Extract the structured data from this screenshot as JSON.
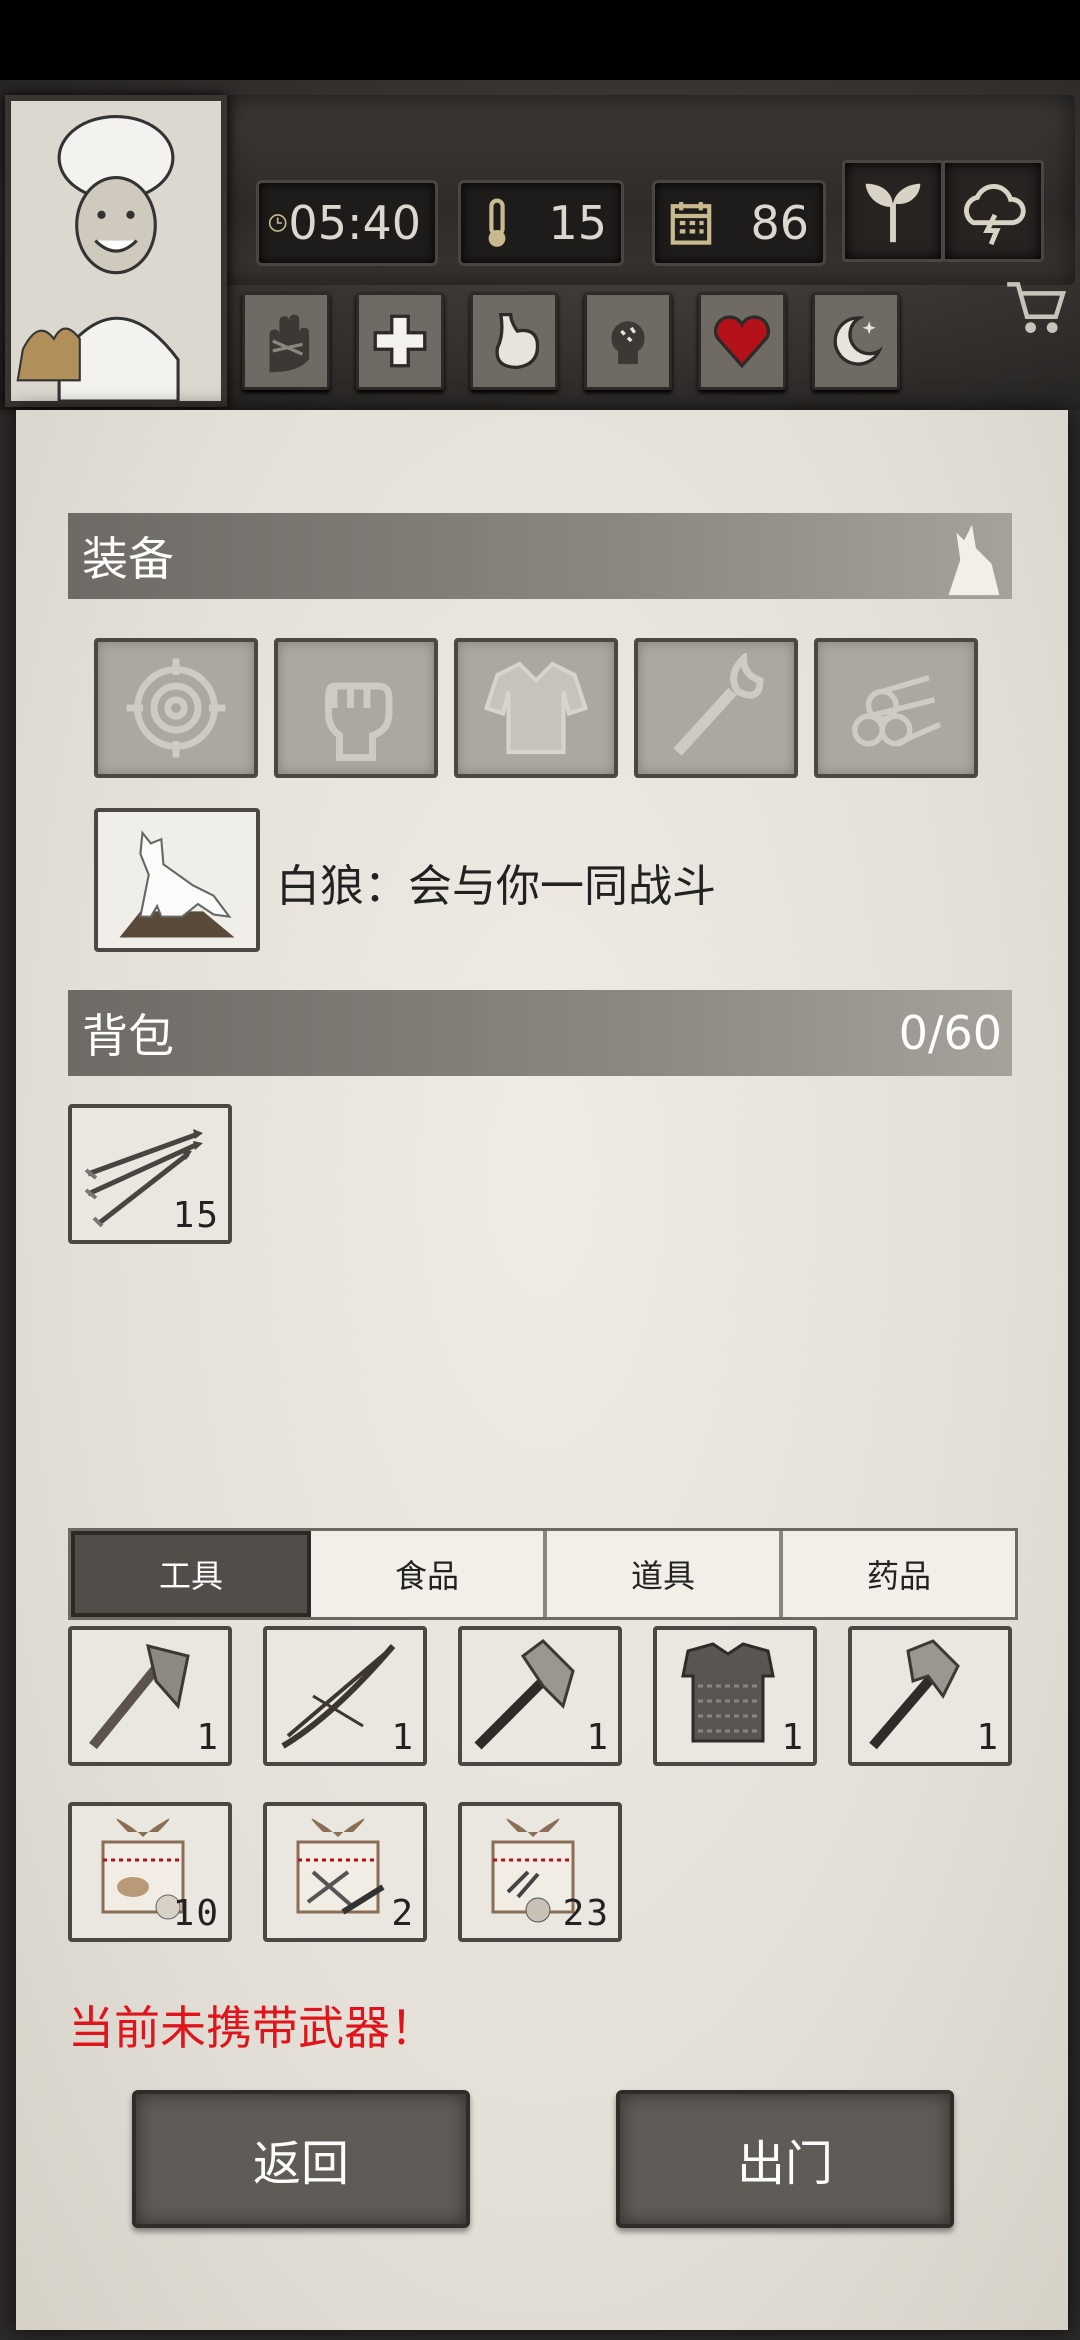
{
  "status": {
    "time": "05:40",
    "temperature": "15",
    "day": "86"
  },
  "top_buttons": [
    "seedling-icon",
    "storm-cloud-icon"
  ],
  "condition_buttons": [
    "bandaged-hand-icon",
    "medical-cross-icon",
    "stomach-icon",
    "head-mind-icon",
    "heart-icon",
    "moon-star-icon"
  ],
  "equipment": {
    "title": "装备",
    "slots": [
      "target-icon",
      "fist-icon",
      "shirt-icon",
      "torch-icon",
      "firewood-icon"
    ],
    "pet_text": "白狼：会与你一同战斗"
  },
  "backpack": {
    "title": "背包",
    "capacity": "0/60",
    "items": [
      {
        "icon": "arrows-icon",
        "count": "15"
      }
    ]
  },
  "tabs": [
    "工具",
    "食品",
    "道具",
    "药品"
  ],
  "active_tab": "工具",
  "tool_items": [
    {
      "icon": "stone-axe-icon",
      "count": "1"
    },
    {
      "icon": "crossbow-icon",
      "count": "1"
    },
    {
      "icon": "iron-axe-icon",
      "count": "1"
    },
    {
      "icon": "chainmail-icon",
      "count": "1"
    },
    {
      "icon": "pickaxe-icon",
      "count": "1"
    },
    {
      "icon": "food-gift-box-icon",
      "count": "10"
    },
    {
      "icon": "weapon-gift-box-icon",
      "count": "2"
    },
    {
      "icon": "item-gift-box-icon",
      "count": "23"
    }
  ],
  "warning": "当前未携带武器！",
  "buttons": {
    "back": "返回",
    "go_out": "出门"
  }
}
